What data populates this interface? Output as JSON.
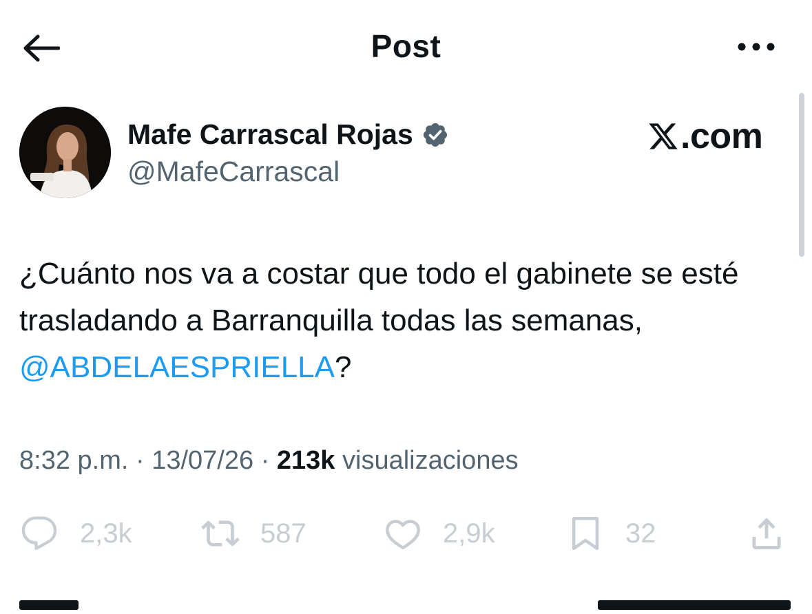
{
  "header": {
    "title": "Post",
    "back_icon": "arrow-left-icon",
    "more_icon": "ellipsis-icon"
  },
  "author": {
    "name": "Mafe Carrascal Rojas",
    "handle": "@MafeCarrascal",
    "verified": true,
    "verified_color": "#536471"
  },
  "brand": {
    "domain": ".com",
    "icon": "x-logo-icon"
  },
  "tweet": {
    "text_before": "¿Cuánto nos va a costar que todo el gabinete se esté trasladando a Barranquilla todas las semanas, ",
    "mention": "@ABDELAESPRIELLA",
    "text_after": "?"
  },
  "meta": {
    "time": "8:32 p.m.",
    "separator": " · ",
    "date": "13/07/26",
    "views": "213k",
    "views_label": "visualizaciones"
  },
  "actions": {
    "replies": "2,3k",
    "reposts": "587",
    "likes": "2,9k",
    "bookmarks": "32"
  },
  "colors": {
    "text": "#0f1419",
    "secondary": "#536471",
    "link": "#1d9bf0",
    "action": "#c7cdd2"
  }
}
